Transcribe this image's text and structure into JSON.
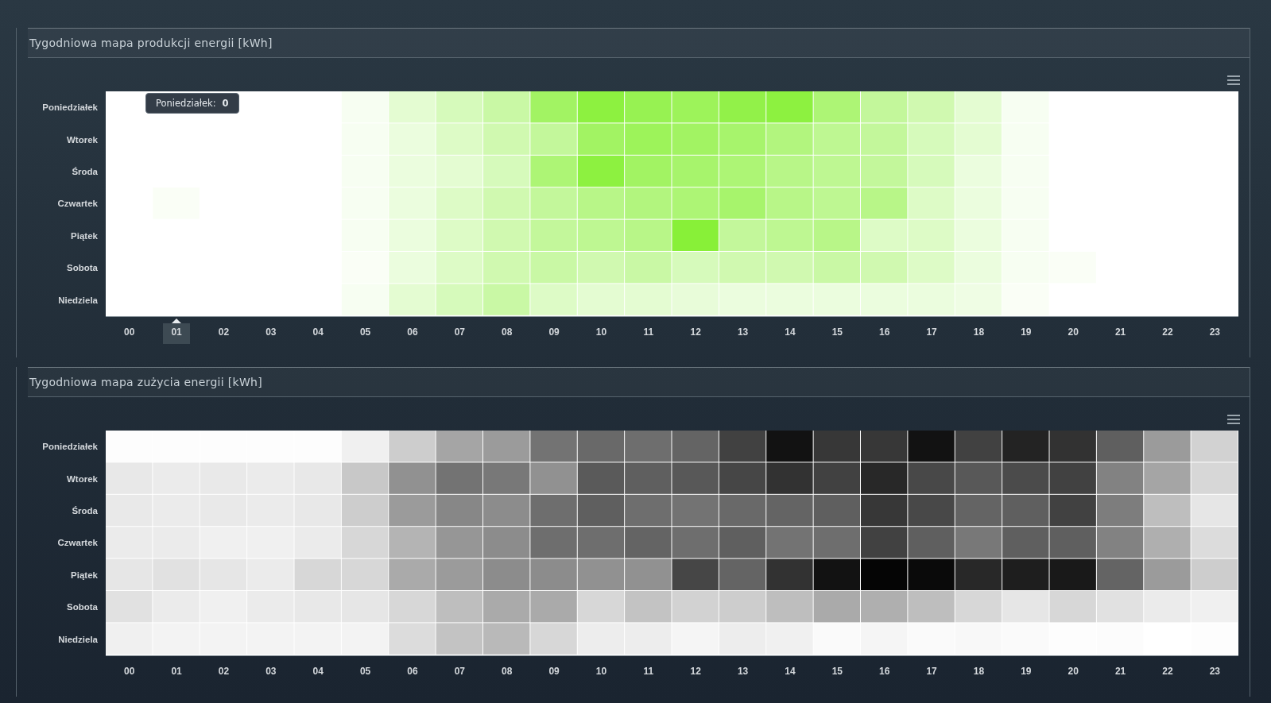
{
  "panels": [
    {
      "kind": "production",
      "title": "Tygodniowa mapa produkcji energii [kWh]",
      "days": [
        "Poniedziałek",
        "Wtorek",
        "Środa",
        "Czwartek",
        "Piątek",
        "Sobota",
        "Niedziela"
      ],
      "hours": [
        {
          "label": "00",
          "selected": false
        },
        {
          "label": "01",
          "selected": true
        },
        {
          "label": "02",
          "selected": false
        },
        {
          "label": "03",
          "selected": false
        },
        {
          "label": "04",
          "selected": false
        },
        {
          "label": "05",
          "selected": false
        },
        {
          "label": "06",
          "selected": false
        },
        {
          "label": "07",
          "selected": false
        },
        {
          "label": "08",
          "selected": false
        },
        {
          "label": "09",
          "selected": false
        },
        {
          "label": "10",
          "selected": false
        },
        {
          "label": "11",
          "selected": false
        },
        {
          "label": "12",
          "selected": false
        },
        {
          "label": "13",
          "selected": false
        },
        {
          "label": "14",
          "selected": false
        },
        {
          "label": "15",
          "selected": false
        },
        {
          "label": "16",
          "selected": false
        },
        {
          "label": "17",
          "selected": false
        },
        {
          "label": "18",
          "selected": false
        },
        {
          "label": "19",
          "selected": false
        },
        {
          "label": "20",
          "selected": false
        },
        {
          "label": "21",
          "selected": false
        },
        {
          "label": "22",
          "selected": false
        },
        {
          "label": "23",
          "selected": false
        }
      ],
      "tooltip": {
        "label": "Poniedziałek:",
        "value": "0"
      }
    },
    {
      "kind": "consumption",
      "title": "Tygodniowa mapa zużycia energii [kWh]",
      "days": [
        "Poniedziałek",
        "Wtorek",
        "Środa",
        "Czwartek",
        "Piątek",
        "Sobota",
        "Niedziela"
      ],
      "hours": [
        {
          "label": "00",
          "selected": false
        },
        {
          "label": "01",
          "selected": false
        },
        {
          "label": "02",
          "selected": false
        },
        {
          "label": "03",
          "selected": false
        },
        {
          "label": "04",
          "selected": false
        },
        {
          "label": "05",
          "selected": false
        },
        {
          "label": "06",
          "selected": false
        },
        {
          "label": "07",
          "selected": false
        },
        {
          "label": "08",
          "selected": false
        },
        {
          "label": "09",
          "selected": false
        },
        {
          "label": "10",
          "selected": false
        },
        {
          "label": "11",
          "selected": false
        },
        {
          "label": "12",
          "selected": false
        },
        {
          "label": "13",
          "selected": false
        },
        {
          "label": "14",
          "selected": false
        },
        {
          "label": "15",
          "selected": false
        },
        {
          "label": "16",
          "selected": false
        },
        {
          "label": "17",
          "selected": false
        },
        {
          "label": "18",
          "selected": false
        },
        {
          "label": "19",
          "selected": false
        },
        {
          "label": "20",
          "selected": false
        },
        {
          "label": "21",
          "selected": false
        },
        {
          "label": "22",
          "selected": false
        },
        {
          "label": "23",
          "selected": false
        }
      ]
    }
  ]
}
